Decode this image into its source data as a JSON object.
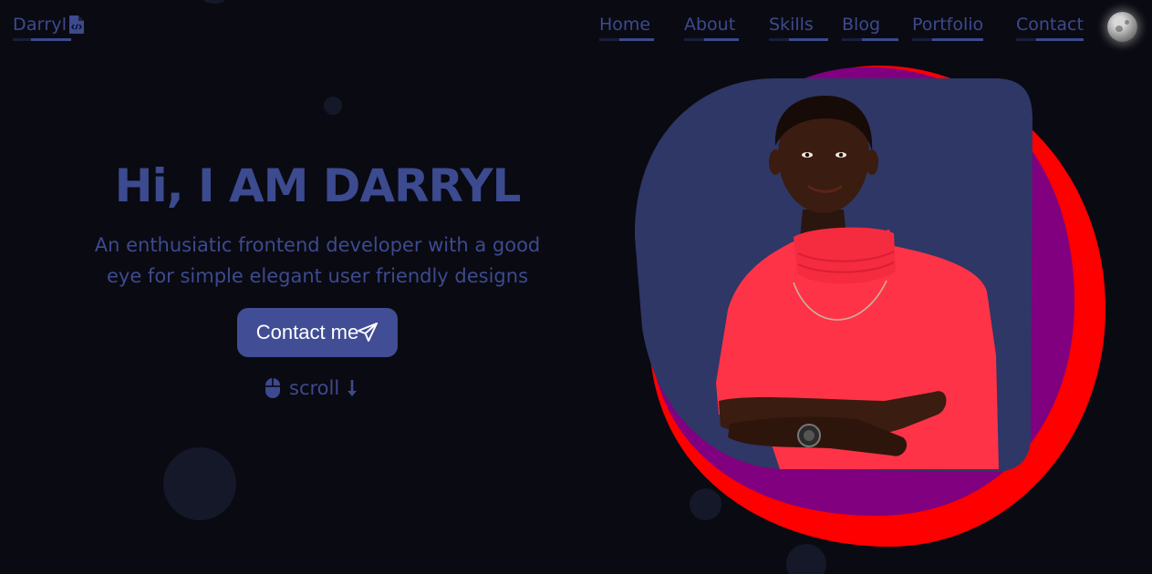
{
  "header": {
    "logo_text": "Darryl",
    "nav": [
      {
        "label": "Home"
      },
      {
        "label": "About"
      },
      {
        "label": "Skills"
      },
      {
        "label": "Blog"
      },
      {
        "label": "Portfolio"
      },
      {
        "label": "Contact"
      }
    ],
    "theme_toggle_icon": "moon-icon"
  },
  "hero": {
    "title": "Hi, I AM DARRYL",
    "subtitle_line1": "An enthusiatic frontend developer with a good",
    "subtitle_line2": "eye for simple elegant user friendly designs",
    "cta_label": "Contact me",
    "cta_icon": "paper-plane-icon",
    "scroll_label": "scroll",
    "scroll_icons": [
      "mouse-icon",
      "arrow-down-icon"
    ]
  },
  "colors": {
    "background": "#0a0a12",
    "accent": "#3c4a8f",
    "button": "#414d94",
    "blob_red": "#ff0000",
    "blob_purple": "#800080",
    "blob_navy": "#2e3766",
    "shirt": "#ff3347"
  }
}
